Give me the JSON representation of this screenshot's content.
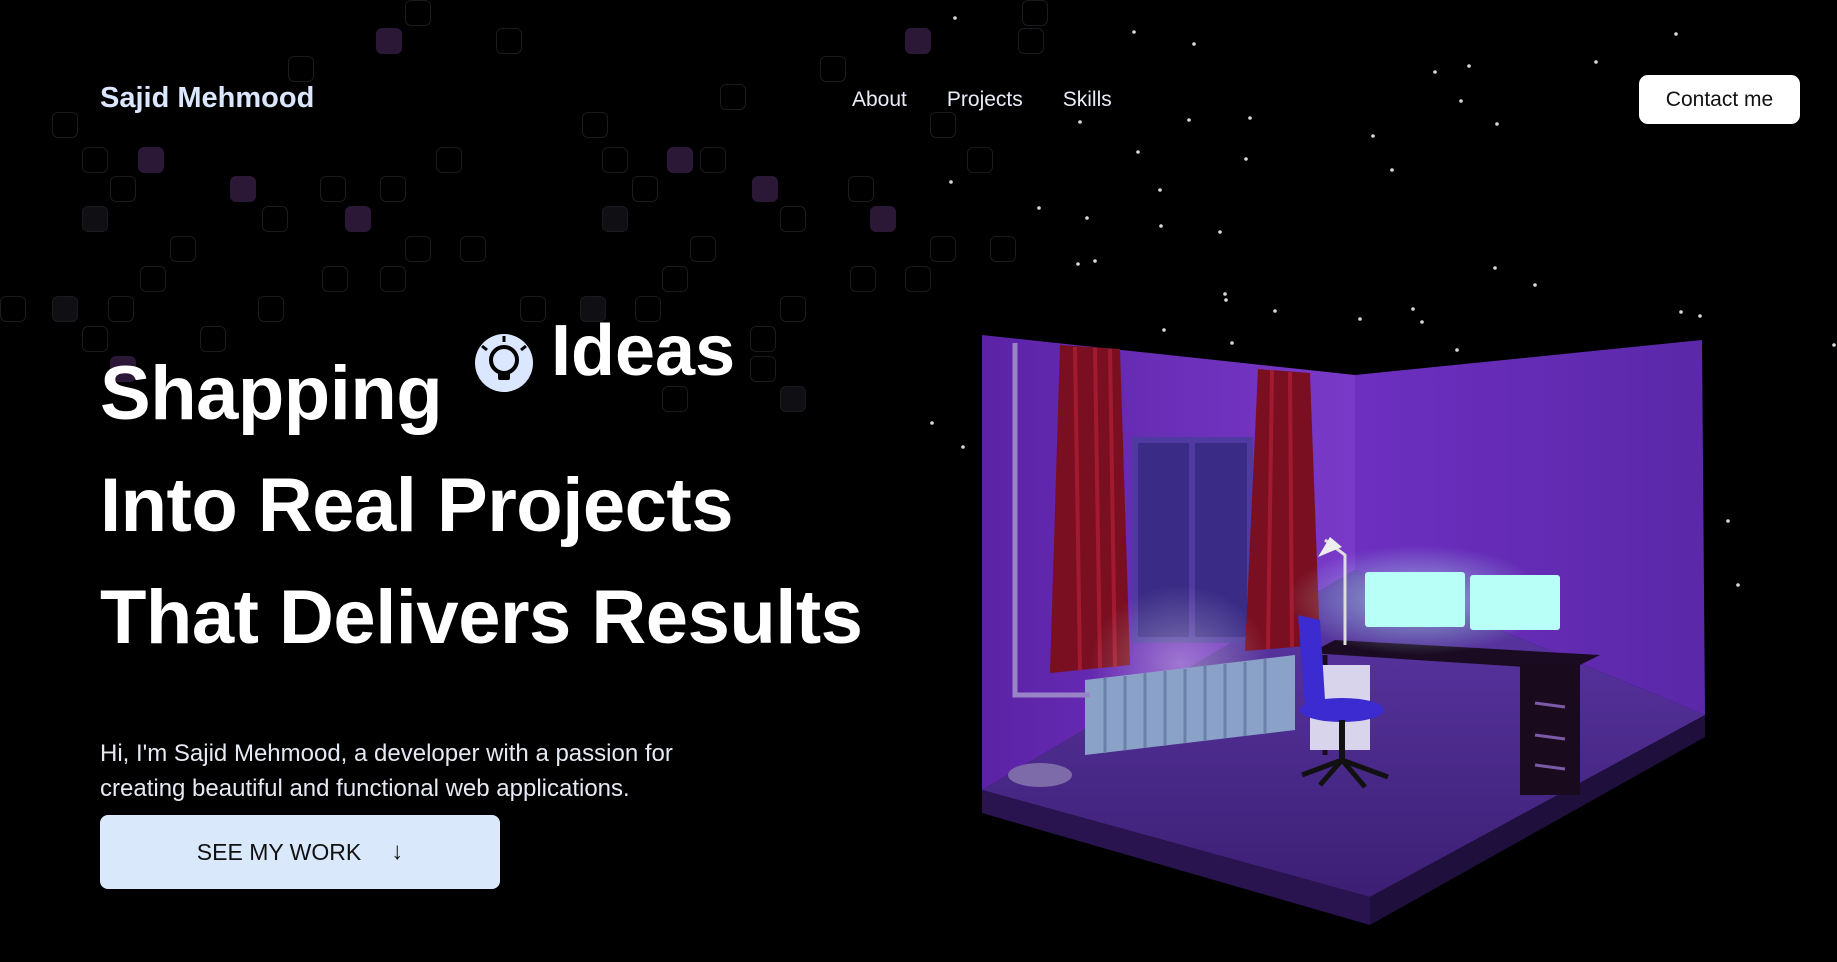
{
  "navbar": {
    "brand": "Sajid Mehmood",
    "links": [
      "About",
      "Projects",
      "Skills"
    ],
    "contact_label": "Contact me"
  },
  "hero": {
    "headline_line1": "Shapping",
    "rotating_word": "Ideas",
    "rotating_icon": "lightbulb-icon",
    "headline_line2": "Into Real Projects",
    "headline_line3": "That Delivers Results",
    "subtext": "Hi, I'm Sajid Mehmood, a developer with a passion for creating beautiful and functional web applications.",
    "cta_label": "SEE MY WORK",
    "cta_icon": "arrow-down-icon"
  },
  "illustration": {
    "name": "isometric-room-3d",
    "colors": {
      "wall": "#6a2fb8",
      "floor": "#4a2a86",
      "curtain": "#8a1022",
      "monitor": "#b8fff7"
    }
  },
  "colors": {
    "background": "#000000",
    "brand_text": "#dbe6ff",
    "cta_bg": "#d9e8fb",
    "contact_bg": "#ffffff"
  }
}
